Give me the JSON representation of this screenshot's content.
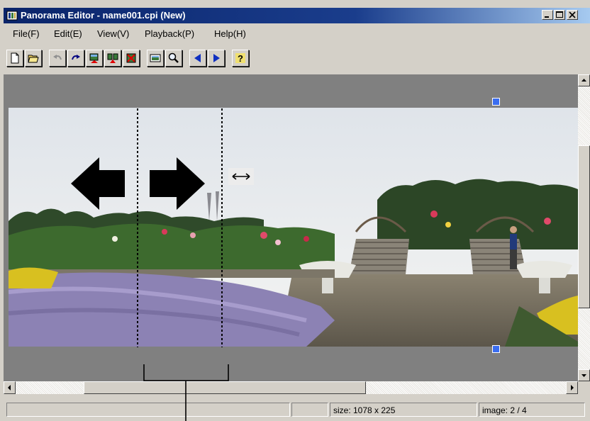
{
  "window": {
    "title": "Panorama Editor - name001.cpi (New)",
    "buttons": [
      "minimize",
      "maximize",
      "close"
    ]
  },
  "menu": {
    "items": [
      {
        "label": "File(F)"
      },
      {
        "label": "Edit(E)"
      },
      {
        "label": "View(V)"
      },
      {
        "label": "Playback(P)"
      },
      {
        "label": "Help(H)"
      }
    ]
  },
  "toolbar": {
    "buttons": [
      {
        "name": "new-icon"
      },
      {
        "name": "open-folder-icon"
      },
      {
        "name": "undo-icon"
      },
      {
        "name": "redo-icon"
      },
      {
        "name": "insert-image-icon"
      },
      {
        "name": "swap-images-icon"
      },
      {
        "name": "delete-image-icon"
      },
      {
        "name": "preview-icon"
      },
      {
        "name": "zoom-icon"
      },
      {
        "name": "previous-icon"
      },
      {
        "name": "next-icon"
      },
      {
        "name": "help-icon"
      }
    ]
  },
  "status": {
    "size": "size: 1078 x 225",
    "image": "image: 2 / 4"
  },
  "colors": {
    "titlebar": "#0a246a",
    "canvas": "#808080",
    "marker": "#3a6df0"
  }
}
